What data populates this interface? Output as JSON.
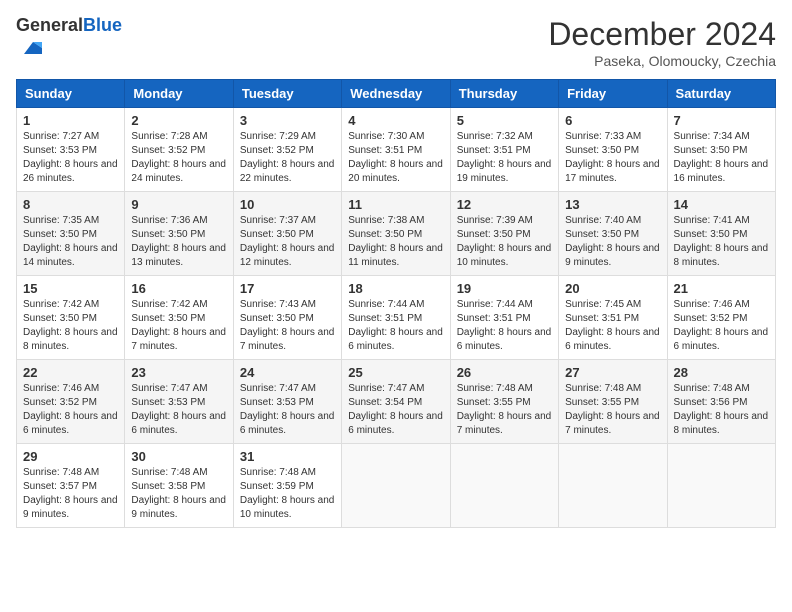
{
  "logo": {
    "general": "General",
    "blue": "Blue"
  },
  "title": "December 2024",
  "location": "Paseka, Olomoucky, Czechia",
  "days_of_week": [
    "Sunday",
    "Monday",
    "Tuesday",
    "Wednesday",
    "Thursday",
    "Friday",
    "Saturday"
  ],
  "weeks": [
    [
      {
        "day": "1",
        "sunrise": "7:27 AM",
        "sunset": "3:53 PM",
        "daylight": "8 hours and 26 minutes."
      },
      {
        "day": "2",
        "sunrise": "7:28 AM",
        "sunset": "3:52 PM",
        "daylight": "8 hours and 24 minutes."
      },
      {
        "day": "3",
        "sunrise": "7:29 AM",
        "sunset": "3:52 PM",
        "daylight": "8 hours and 22 minutes."
      },
      {
        "day": "4",
        "sunrise": "7:30 AM",
        "sunset": "3:51 PM",
        "daylight": "8 hours and 20 minutes."
      },
      {
        "day": "5",
        "sunrise": "7:32 AM",
        "sunset": "3:51 PM",
        "daylight": "8 hours and 19 minutes."
      },
      {
        "day": "6",
        "sunrise": "7:33 AM",
        "sunset": "3:50 PM",
        "daylight": "8 hours and 17 minutes."
      },
      {
        "day": "7",
        "sunrise": "7:34 AM",
        "sunset": "3:50 PM",
        "daylight": "8 hours and 16 minutes."
      }
    ],
    [
      {
        "day": "8",
        "sunrise": "7:35 AM",
        "sunset": "3:50 PM",
        "daylight": "8 hours and 14 minutes."
      },
      {
        "day": "9",
        "sunrise": "7:36 AM",
        "sunset": "3:50 PM",
        "daylight": "8 hours and 13 minutes."
      },
      {
        "day": "10",
        "sunrise": "7:37 AM",
        "sunset": "3:50 PM",
        "daylight": "8 hours and 12 minutes."
      },
      {
        "day": "11",
        "sunrise": "7:38 AM",
        "sunset": "3:50 PM",
        "daylight": "8 hours and 11 minutes."
      },
      {
        "day": "12",
        "sunrise": "7:39 AM",
        "sunset": "3:50 PM",
        "daylight": "8 hours and 10 minutes."
      },
      {
        "day": "13",
        "sunrise": "7:40 AM",
        "sunset": "3:50 PM",
        "daylight": "8 hours and 9 minutes."
      },
      {
        "day": "14",
        "sunrise": "7:41 AM",
        "sunset": "3:50 PM",
        "daylight": "8 hours and 8 minutes."
      }
    ],
    [
      {
        "day": "15",
        "sunrise": "7:42 AM",
        "sunset": "3:50 PM",
        "daylight": "8 hours and 8 minutes."
      },
      {
        "day": "16",
        "sunrise": "7:42 AM",
        "sunset": "3:50 PM",
        "daylight": "8 hours and 7 minutes."
      },
      {
        "day": "17",
        "sunrise": "7:43 AM",
        "sunset": "3:50 PM",
        "daylight": "8 hours and 7 minutes."
      },
      {
        "day": "18",
        "sunrise": "7:44 AM",
        "sunset": "3:51 PM",
        "daylight": "8 hours and 6 minutes."
      },
      {
        "day": "19",
        "sunrise": "7:44 AM",
        "sunset": "3:51 PM",
        "daylight": "8 hours and 6 minutes."
      },
      {
        "day": "20",
        "sunrise": "7:45 AM",
        "sunset": "3:51 PM",
        "daylight": "8 hours and 6 minutes."
      },
      {
        "day": "21",
        "sunrise": "7:46 AM",
        "sunset": "3:52 PM",
        "daylight": "8 hours and 6 minutes."
      }
    ],
    [
      {
        "day": "22",
        "sunrise": "7:46 AM",
        "sunset": "3:52 PM",
        "daylight": "8 hours and 6 minutes."
      },
      {
        "day": "23",
        "sunrise": "7:47 AM",
        "sunset": "3:53 PM",
        "daylight": "8 hours and 6 minutes."
      },
      {
        "day": "24",
        "sunrise": "7:47 AM",
        "sunset": "3:53 PM",
        "daylight": "8 hours and 6 minutes."
      },
      {
        "day": "25",
        "sunrise": "7:47 AM",
        "sunset": "3:54 PM",
        "daylight": "8 hours and 6 minutes."
      },
      {
        "day": "26",
        "sunrise": "7:48 AM",
        "sunset": "3:55 PM",
        "daylight": "8 hours and 7 minutes."
      },
      {
        "day": "27",
        "sunrise": "7:48 AM",
        "sunset": "3:55 PM",
        "daylight": "8 hours and 7 minutes."
      },
      {
        "day": "28",
        "sunrise": "7:48 AM",
        "sunset": "3:56 PM",
        "daylight": "8 hours and 8 minutes."
      }
    ],
    [
      {
        "day": "29",
        "sunrise": "7:48 AM",
        "sunset": "3:57 PM",
        "daylight": "8 hours and 9 minutes."
      },
      {
        "day": "30",
        "sunrise": "7:48 AM",
        "sunset": "3:58 PM",
        "daylight": "8 hours and 9 minutes."
      },
      {
        "day": "31",
        "sunrise": "7:48 AM",
        "sunset": "3:59 PM",
        "daylight": "8 hours and 10 minutes."
      },
      null,
      null,
      null,
      null
    ]
  ],
  "labels": {
    "sunrise": "Sunrise:",
    "sunset": "Sunset:",
    "daylight": "Daylight:"
  }
}
